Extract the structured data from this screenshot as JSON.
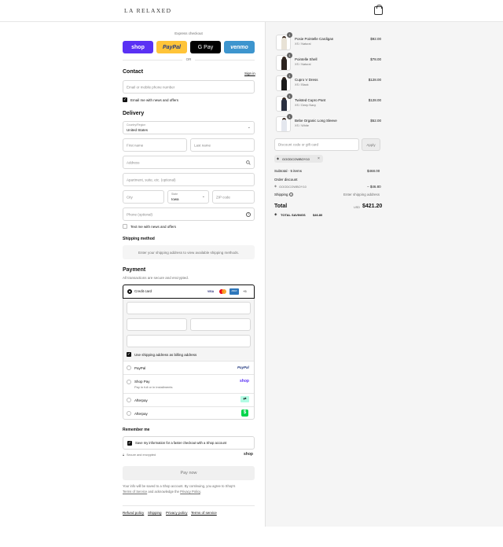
{
  "header": {
    "logo": "LA RELAXED",
    "bag_icon": "shopping-bag-icon"
  },
  "express": {
    "label": "Express checkout",
    "buttons": [
      {
        "label": "shop",
        "color": "#5a31f4"
      },
      {
        "label": "PayPal",
        "color": "#ffc439"
      },
      {
        "label": "G Pay",
        "color": "#000000"
      },
      {
        "label": "venmo",
        "color": "#3d95ce"
      }
    ],
    "or": "OR"
  },
  "contact": {
    "title": "Contact",
    "sign_in": "Sign in",
    "email_placeholder": "Email or mobile phone number",
    "news_label": "Email me with news and offers"
  },
  "delivery": {
    "title": "Delivery",
    "country_label": "Country/Region",
    "country_value": "United States",
    "first_name": "First name",
    "last_name": "Last name",
    "address": "Address",
    "apartment": "Apartment, suite, etc. (optional)",
    "city": "City",
    "state_label": "State",
    "state_value": "Iowa",
    "zip": "ZIP code",
    "phone": "Phone (optional)",
    "text_news": "Text me with news and offers"
  },
  "shipping_method": {
    "title": "Shipping method",
    "message": "Enter your shipping address to view available shipping methods."
  },
  "payment": {
    "title": "Payment",
    "subtitle": "All transactions are secure and encrypted.",
    "credit_card": "Credit card",
    "card_brands": [
      "VISA",
      "MC",
      "AMEX",
      "+5"
    ],
    "billing_same": "Use shipping address as billing address",
    "options": [
      {
        "name": "PayPal",
        "badge": "PayPal"
      },
      {
        "name": "Shop Pay",
        "sub": "Pay in full or in installments",
        "badge": "shop"
      },
      {
        "name": "Afterpay",
        "badge": "afterpay-icon"
      },
      {
        "name": "Afterpay",
        "badge": "$"
      }
    ]
  },
  "remember": {
    "title": "Remember me",
    "save_label": "Save my information for a faster checkout with a Shop account",
    "secure": "Secure and encrypted",
    "shop": "shop"
  },
  "pay_now": "Pay now",
  "legal": {
    "line1": "Your info will be saved to a Shop account. By continuing, you agree to Shop's",
    "tos": "Terms of Service",
    "and": "and acknowledge the",
    "privacy": "Privacy Policy",
    "period": "."
  },
  "footer_links": [
    "Refund policy",
    "Shipping",
    "Privacy policy",
    "Terms of service"
  ],
  "cart": {
    "items": [
      {
        "qty": "1",
        "name": "Posie Pointelle Cardigan",
        "variant": "XS / Natural",
        "price": "$92.00",
        "color": "#e8e2d6"
      },
      {
        "qty": "1",
        "name": "Pointelle Shell",
        "variant": "XS / Natural",
        "price": "$78.00",
        "color": "#2c2420"
      },
      {
        "qty": "1",
        "name": "Cupro V Dress",
        "variant": "XS / Black",
        "price": "$128.00",
        "color": "#1a1a1a"
      },
      {
        "qty": "1",
        "name": "Twisted Cupro Pant",
        "variant": "XS / Deep Navy",
        "price": "$128.00",
        "color": "#2a3040"
      },
      {
        "qty": "1",
        "name": "Bebe Organic Long Sleeve",
        "variant": "XS / White",
        "price": "$52.00",
        "color": "#e4e7ee"
      }
    ],
    "discount_placeholder": "Discount code or gift card",
    "apply": "Apply",
    "applied_code": "GOODCOWBOY10",
    "subtotal_label": "Subtotal · 5 items",
    "subtotal_value": "$468.00",
    "order_discount": "Order discount",
    "discount_code": "GOODCOWBOY10",
    "discount_value": "− $46.80",
    "shipping_label": "Shipping",
    "shipping_value": "Enter shipping address",
    "total_label": "Total",
    "currency": "USD",
    "total_value": "$421.20",
    "savings_label": "TOTAL SAVINGS",
    "savings_value": "$46.80"
  }
}
